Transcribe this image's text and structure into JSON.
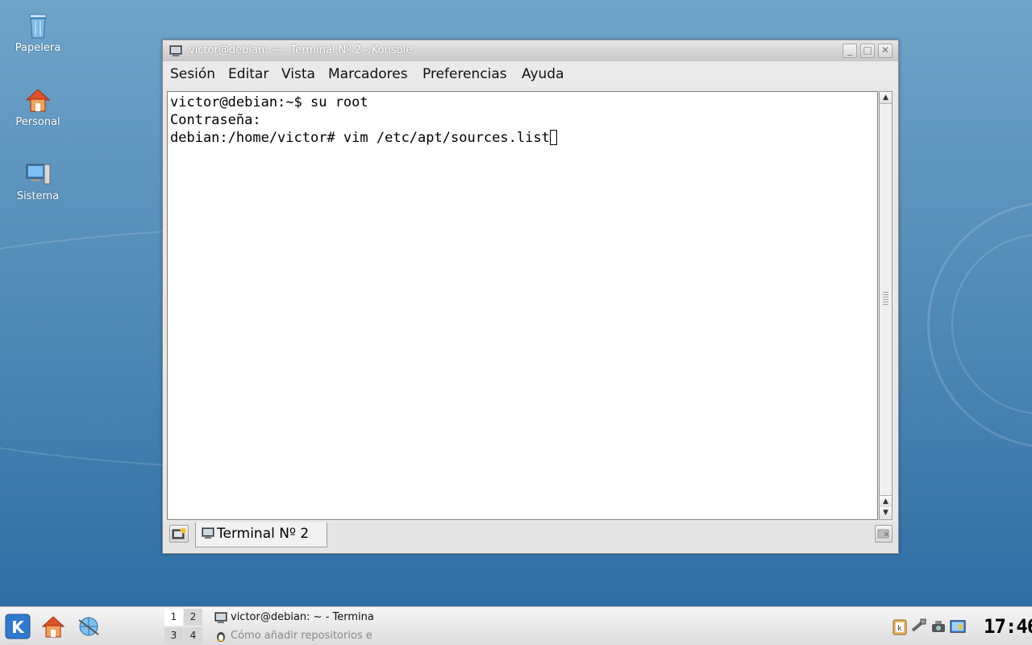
{
  "desktop": {
    "icons": [
      {
        "label": "Papelera",
        "icon": "trash-icon"
      },
      {
        "label": "Personal",
        "icon": "home-icon"
      },
      {
        "label": "Sistema",
        "icon": "computer-icon"
      }
    ]
  },
  "window": {
    "title": "victor@debian: ~ - Terminal Nº 2 - Konsole",
    "menu": [
      "Sesión",
      "Editar",
      "Vista",
      "Marcadores",
      "Preferencias",
      "Ayuda"
    ],
    "terminal_lines": [
      "victor@debian:~$ su root",
      "Contraseña:",
      "debian:/home/victor# vim /etc/apt/sources.list"
    ],
    "tab_label": "Terminal Nº 2"
  },
  "taskbar": {
    "pager": [
      "1",
      "2",
      "3",
      "4"
    ],
    "tasks": [
      {
        "label": "victor@debian: ~ - Termina",
        "icon": "terminal-icon"
      },
      {
        "label": "Cómo añadir repositorios e",
        "icon": "linux-icon"
      }
    ],
    "clock": "17:46"
  },
  "colors": {
    "desktop_top": "#6fa4c9",
    "desktop_bottom": "#2f6ea5",
    "window_frame": "#e8e8e8",
    "terminal_bg": "#ffffff"
  }
}
